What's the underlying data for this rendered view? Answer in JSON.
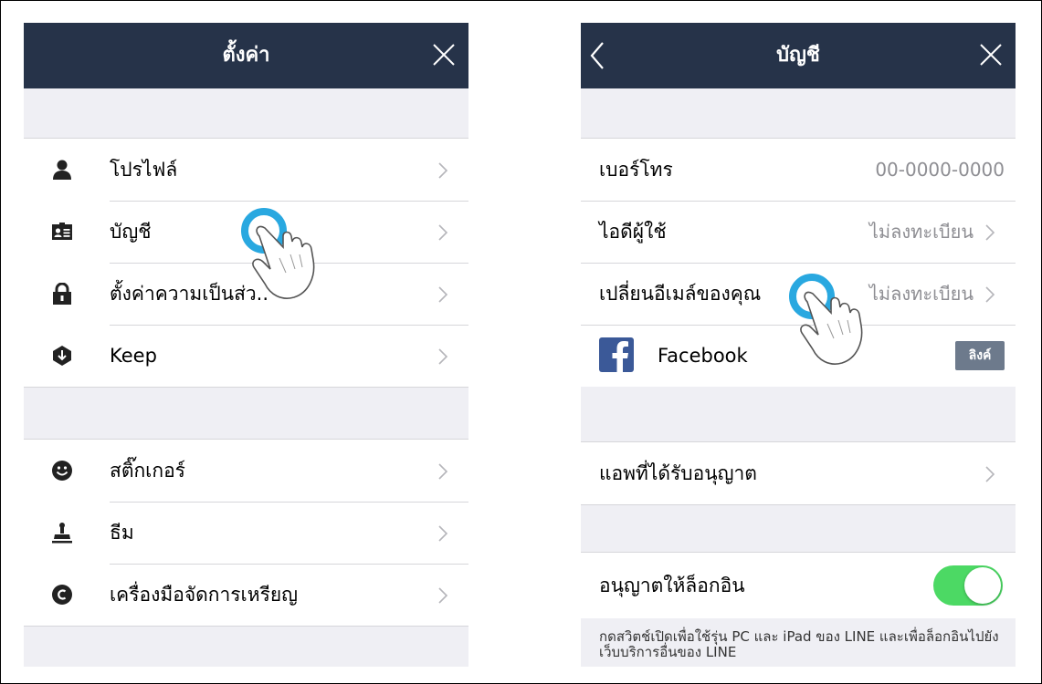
{
  "settings": {
    "title": "ตั้งค่า",
    "groups": [
      {
        "items": [
          {
            "label": "โปรไฟล์",
            "icon": "profile-icon"
          },
          {
            "label": "บัญชี",
            "icon": "account-card-icon"
          },
          {
            "label": "ตั้งค่าความเป็นส่ว..",
            "icon": "lock-icon"
          },
          {
            "label": "Keep",
            "icon": "keep-icon"
          }
        ]
      },
      {
        "items": [
          {
            "label": "สติ๊กเกอร์",
            "icon": "smiley-icon"
          },
          {
            "label": "ธีม",
            "icon": "theme-stamp-icon"
          },
          {
            "label": "เครื่องมือจัดการเหรียญ",
            "icon": "coin-icon"
          }
        ]
      }
    ]
  },
  "account": {
    "title": "บัญชี",
    "rows": [
      {
        "label": "เบอร์โทร",
        "value": "00-0000-0000"
      },
      {
        "label": "ไอดีผู้ใช้",
        "value": "ไม่ลงทะเบียน"
      },
      {
        "label": "เปลี่ยนอีเมล์ของคุณ",
        "value": "ไม่ลงทะเบียน"
      },
      {
        "label": "Facebook",
        "button": "ลิงค์"
      }
    ],
    "authorized_apps": "แอพที่ได้รับอนุญาต",
    "allow_login": {
      "label": "อนุญาตให้ล็อกอิน",
      "on": true
    },
    "footnote": "กดสวิตช์เปิดเพื่อใช้รุ่น PC และ iPad ของ LINE และเพื่อล็อกอินไปยังเว็บบริการอื่นของ LINE"
  },
  "colors": {
    "navbar": "#263349",
    "tap": "#29a8e0",
    "toggle_on": "#4cd964",
    "background": "#efeff4"
  }
}
